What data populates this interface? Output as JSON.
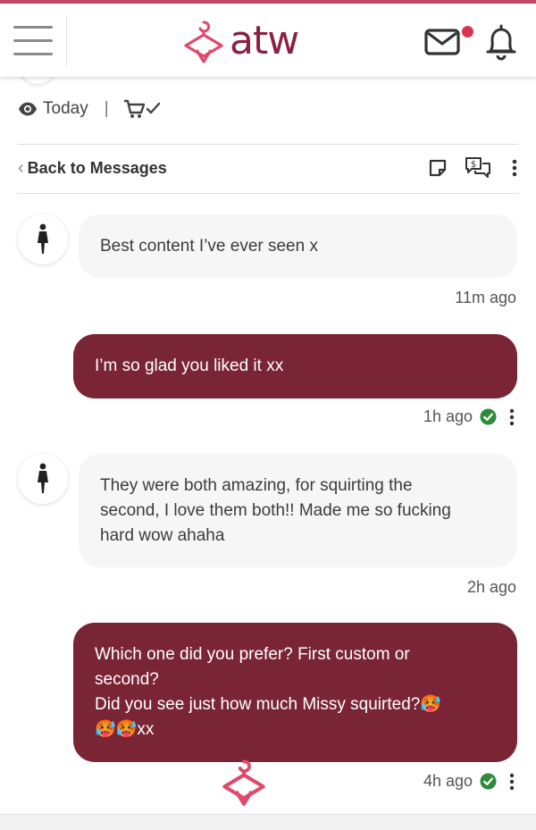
{
  "header": {
    "logo_text": "atw",
    "menu_icon": "hamburger-menu-icon",
    "mail_icon": "envelope-icon",
    "bell_icon": "bell-icon",
    "notification_color": "#d9344d",
    "brand_color": "#8b2040",
    "accent_color": "#e0496c"
  },
  "meta": {
    "visibility_label": "Today",
    "separator": "|"
  },
  "message_bar": {
    "back_label": "Back to Messages",
    "icons": [
      "note-icon",
      "paid-message-icon",
      "more-vertical-icon"
    ]
  },
  "messages": [
    {
      "direction": "in",
      "text": "Best content I’ve ever seen x",
      "time": "11m ago"
    },
    {
      "direction": "out",
      "text": "I’m so glad you liked it xx",
      "time": "1h ago",
      "status": "read"
    },
    {
      "direction": "in",
      "lines": [
        "They were both amazing, for squirting the",
        "second, I love them both!! Made me so fucking",
        "hard wow ahaha"
      ],
      "time": "2h ago"
    },
    {
      "direction": "out",
      "lines": [
        "Which one did you prefer? First custom or",
        "second?",
        "Did you see just how much Missy squirted?🥵",
        "🥵🥵xx"
      ],
      "time": "4h ago",
      "status": "read"
    }
  ],
  "colors": {
    "incoming_bubble": "#f6f6f7",
    "outgoing_bubble": "#7a2536",
    "read_check": "#2e8b3a"
  }
}
